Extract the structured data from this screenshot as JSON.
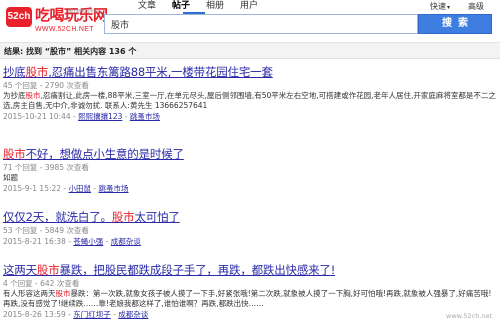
{
  "logo": {
    "mark": "52ch",
    "title": "吃喝玩乐网",
    "tagline": "重庆吃喝玩乐网",
    "url": "WWW.52CH.NET"
  },
  "tabs": [
    {
      "label": "文章",
      "active": false
    },
    {
      "label": "帖子",
      "active": true
    },
    {
      "label": "相册",
      "active": false
    },
    {
      "label": "用户",
      "active": false
    }
  ],
  "quick_menu": {
    "label": "快速",
    "arrow": "▾"
  },
  "advanced": "高级",
  "search": {
    "value": "股市",
    "button": "搜索"
  },
  "results_summary": "结果: 找到 “股市” 相关内容 136 个",
  "results": [
    {
      "title_parts": [
        "抄底",
        "股市",
        ",忍痛出售东篱路88平米,一楼带花园住宅一套"
      ],
      "meta": "45 个回复 - 2790 次查看",
      "snippet_parts": [
        "为抄底",
        "股市",
        ",忍痛割让,此房一楼,88平米,三室一厅,在单元尽头,屋后侧邻围墙,有50平米左右空地,可搭建或作花园,老年人居住,开家庭麻将室都是不二之选,房主自售,无中介,非诚勿扰. 联系人:黄先生 13666257641"
      ],
      "date": "2015-10-21 10:44",
      "author": "熙熙攘攘123",
      "forum": "跳蚤市场"
    },
    {
      "title_parts": [
        "",
        "股市",
        "不好，想做点小生意的是时候了"
      ],
      "meta": "71 个回复 - 3985 次查看",
      "snippet_parts": [
        "如题",
        "",
        ""
      ],
      "date": "2015-9-1 15:22",
      "author": "小田鼠",
      "forum": "跳蚤市场"
    },
    {
      "title_parts": [
        "仅仅2天，就洗白了。",
        "股市",
        "太可怕了"
      ],
      "meta": "53 个回复 - 5849 次查看",
      "snippet_parts": [
        "",
        "",
        ""
      ],
      "date": "2015-8-21 16:38",
      "author": "苍蝇小强",
      "forum": "成都杂谈"
    },
    {
      "title_parts": [
        "这两天",
        "股市",
        "暴跌，把股民都跌成段子手了，再跌，都跌出快感来了!"
      ],
      "meta": "4 个回复 - 642 次查看",
      "snippet_parts": [
        "有人形容这两天",
        "股市",
        "暴跌：第一次跌,就象女孩子被人摸了一下手,好紧张哦!第二次跌,就象被人摸了一下胸,好可怕哦!再跌,就象被人强暴了,好痛苦哦!再跌,没有感觉了!继续跌……靠!老娘我都这样了,谁怕谁啊？再跌,都跌出快……"
      ],
      "date": "2015-8-26 13:59",
      "author": "东门红坝子",
      "forum": "成都杂谈"
    }
  ],
  "watermark": "www.52ch.net"
}
